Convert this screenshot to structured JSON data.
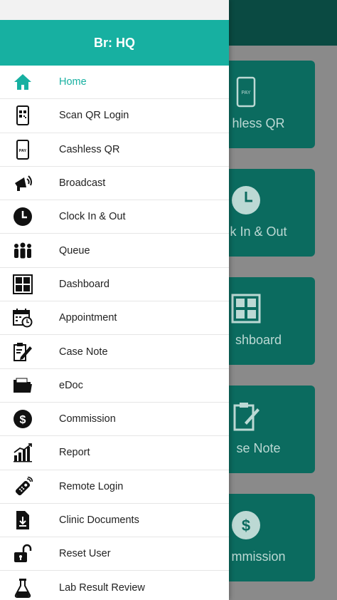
{
  "drawer": {
    "title": "Br: HQ",
    "items": [
      {
        "label": "Home",
        "icon": "home-icon",
        "active": true
      },
      {
        "label": "Scan QR Login",
        "icon": "qr-scan-icon"
      },
      {
        "label": "Cashless QR",
        "icon": "pay-phone-icon"
      },
      {
        "label": "Broadcast",
        "icon": "megaphone-icon"
      },
      {
        "label": "Clock In & Out",
        "icon": "clock-icon"
      },
      {
        "label": "Queue",
        "icon": "people-queue-icon"
      },
      {
        "label": "Dashboard",
        "icon": "dashboard-grid-icon"
      },
      {
        "label": "Appointment",
        "icon": "calendar-clock-icon"
      },
      {
        "label": "Case Note",
        "icon": "clipboard-pen-icon"
      },
      {
        "label": "eDoc",
        "icon": "folder-icon"
      },
      {
        "label": "Commission",
        "icon": "dollar-circle-icon"
      },
      {
        "label": "Report",
        "icon": "bar-chart-icon"
      },
      {
        "label": "Remote Login",
        "icon": "remote-control-icon"
      },
      {
        "label": "Clinic Documents",
        "icon": "document-download-icon"
      },
      {
        "label": "Reset User",
        "icon": "unlock-icon"
      },
      {
        "label": "Lab Result Review",
        "icon": "flask-icon"
      }
    ]
  },
  "background": {
    "tiles": [
      {
        "label": "Cashless QR",
        "visible": "hless QR",
        "icon": "pay-phone-icon"
      },
      {
        "label": "Clock In & Out",
        "visible": "k In & Out",
        "icon": "clock-icon"
      },
      {
        "label": "Dashboard",
        "visible": "shboard",
        "icon": "dashboard-grid-icon"
      },
      {
        "label": "Case Note",
        "visible": "se Note",
        "icon": "clipboard-pen-icon"
      },
      {
        "label": "Commission",
        "visible": "mmission",
        "icon": "dollar-circle-icon"
      }
    ]
  },
  "colors": {
    "accent": "#17b0a1",
    "tile": "#0b6b5f",
    "topbar": "#0a4a42"
  }
}
